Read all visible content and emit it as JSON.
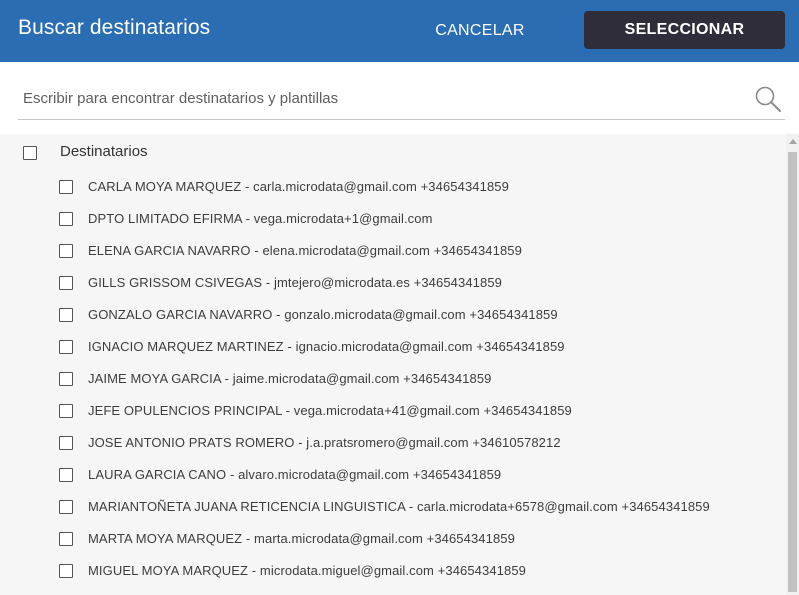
{
  "dialog": {
    "title": "Buscar destinatarios",
    "cancel_label": "CANCELAR",
    "select_label": "SELECCIONAR"
  },
  "search": {
    "placeholder": "Escribir para encontrar destinatarios y plantillas",
    "value": ""
  },
  "group": {
    "label": "Destinatarios",
    "checked": false
  },
  "recipients": [
    {
      "label": "CARLA MOYA MARQUEZ - carla.microdata@gmail.com +34654341859",
      "checked": false
    },
    {
      "label": "DPTO LIMITADO EFIRMA - vega.microdata+1@gmail.com",
      "checked": false
    },
    {
      "label": "ELENA GARCIA NAVARRO - elena.microdata@gmail.com +34654341859",
      "checked": false
    },
    {
      "label": "GILLS GRISSOM CSIVEGAS - jmtejero@microdata.es +34654341859",
      "checked": false
    },
    {
      "label": "GONZALO GARCIA NAVARRO - gonzalo.microdata@gmail.com +34654341859",
      "checked": false
    },
    {
      "label": "IGNACIO MARQUEZ MARTINEZ - ignacio.microdata@gmail.com +34654341859",
      "checked": false
    },
    {
      "label": "JAIME MOYA GARCIA - jaime.microdata@gmail.com +34654341859",
      "checked": false
    },
    {
      "label": "JEFE OPULENCIOS PRINCIPAL - vega.microdata+41@gmail.com +34654341859",
      "checked": false
    },
    {
      "label": "JOSE ANTONIO PRATS ROMERO - j.a.pratsromero@gmail.com +34610578212",
      "checked": false
    },
    {
      "label": "LAURA GARCIA CANO - alvaro.microdata@gmail.com +34654341859",
      "checked": false
    },
    {
      "label": "MARIANTOÑETA JUANA RETICENCIA LINGUISTICA - carla.microdata+6578@gmail.com +34654341859",
      "checked": false
    },
    {
      "label": "MARTA MOYA MARQUEZ - marta.microdata@gmail.com +34654341859",
      "checked": false
    },
    {
      "label": "MIGUEL MOYA MARQUEZ - microdata.miguel@gmail.com +34654341859",
      "checked": false
    }
  ],
  "colors": {
    "header_bg": "#2a6db3",
    "select_button_bg": "#302d3a",
    "list_bg": "#f6f6f6"
  },
  "icons": {
    "search": "search-icon"
  }
}
